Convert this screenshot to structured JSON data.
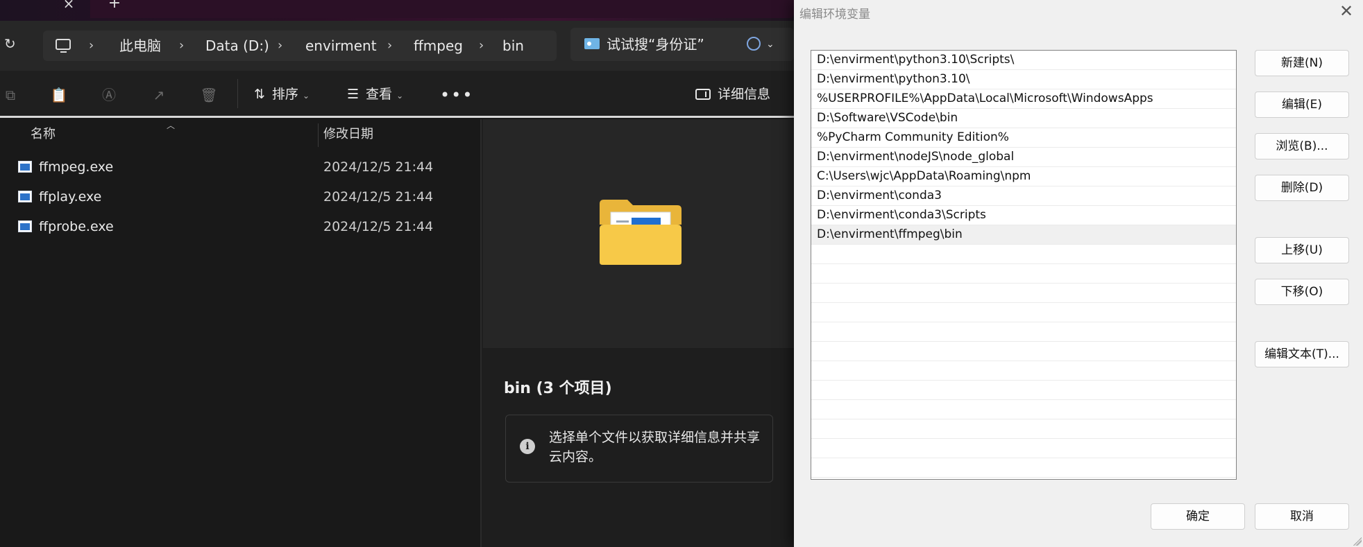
{
  "explorer": {
    "breadcrumb": [
      "此电脑",
      "Data (D:)",
      "envirment",
      "ffmpeg",
      "bin"
    ],
    "search_placeholder": "试试搜“身份证”",
    "toolbar": {
      "sort_label": "排序",
      "view_label": "查看",
      "more_label": "•••",
      "details_label": "详细信息"
    },
    "columns": {
      "name": "名称",
      "modified": "修改日期"
    },
    "files": [
      {
        "name": "ffmpeg.exe",
        "modified": "2024/12/5 21:44"
      },
      {
        "name": "ffplay.exe",
        "modified": "2024/12/5 21:44"
      },
      {
        "name": "ffprobe.exe",
        "modified": "2024/12/5 21:44"
      }
    ],
    "preview": {
      "title": "bin (3 个项目)",
      "info_text": "选择单个文件以获取详细信息并共享云内容。"
    }
  },
  "dialog": {
    "title": "编辑环境变量",
    "paths": [
      "D:\\envirment\\python3.10\\Scripts\\",
      "D:\\envirment\\python3.10\\",
      "%USERPROFILE%\\AppData\\Local\\Microsoft\\WindowsApps",
      "D:\\Software\\VSCode\\bin",
      "%PyCharm Community Edition%",
      "D:\\envirment\\nodeJS\\node_global",
      "C:\\Users\\wjc\\AppData\\Roaming\\npm",
      "D:\\envirment\\conda3",
      "D:\\envirment\\conda3\\Scripts",
      "D:\\envirment\\ffmpeg\\bin"
    ],
    "selected_index": 9,
    "buttons": {
      "new": "新建(N)",
      "edit": "编辑(E)",
      "browse": "浏览(B)...",
      "delete": "删除(D)",
      "move_up": "上移(U)",
      "move_down": "下移(O)",
      "edit_text": "编辑文本(T)...",
      "ok": "确定",
      "cancel": "取消"
    }
  }
}
